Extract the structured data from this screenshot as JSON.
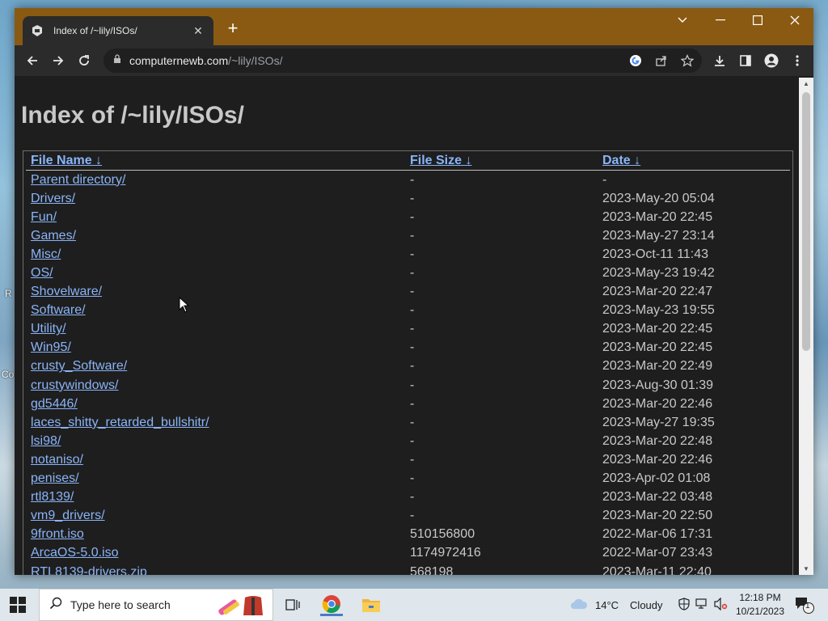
{
  "desktop": {
    "side_letters": [
      "R",
      "Co"
    ]
  },
  "browser": {
    "tab_title": "Index of /~lily/ISOs/",
    "url_domain": "computernewb.com",
    "url_path": "/~lily/ISOs/"
  },
  "page": {
    "heading": "Index of /~lily/ISOs/",
    "columns": [
      "File Name ↓",
      "File Size ↓",
      "Date ↓"
    ],
    "rows": [
      {
        "name": "Parent directory/",
        "size": "-",
        "date": "-"
      },
      {
        "name": "Drivers/",
        "size": "-",
        "date": "2023-May-20 05:04"
      },
      {
        "name": "Fun/",
        "size": "-",
        "date": "2023-Mar-20 22:45"
      },
      {
        "name": "Games/",
        "size": "-",
        "date": "2023-May-27 23:14"
      },
      {
        "name": "Misc/",
        "size": "-",
        "date": "2023-Oct-11 11:43"
      },
      {
        "name": "OS/",
        "size": "-",
        "date": "2023-May-23 19:42"
      },
      {
        "name": "Shovelware/",
        "size": "-",
        "date": "2023-Mar-20 22:47"
      },
      {
        "name": "Software/",
        "size": "-",
        "date": "2023-May-23 19:55"
      },
      {
        "name": "Utility/",
        "size": "-",
        "date": "2023-Mar-20 22:45"
      },
      {
        "name": "Win95/",
        "size": "-",
        "date": "2023-Mar-20 22:45"
      },
      {
        "name": "crusty_Software/",
        "size": "-",
        "date": "2023-Mar-20 22:49"
      },
      {
        "name": "crustywindows/",
        "size": "-",
        "date": "2023-Aug-30 01:39"
      },
      {
        "name": "gd5446/",
        "size": "-",
        "date": "2023-Mar-20 22:46"
      },
      {
        "name": "laces_shitty_retarded_bullshitr/",
        "size": "-",
        "date": "2023-May-27 19:35"
      },
      {
        "name": "lsi98/",
        "size": "-",
        "date": "2023-Mar-20 22:48"
      },
      {
        "name": "notaniso/",
        "size": "-",
        "date": "2023-Mar-20 22:46"
      },
      {
        "name": "penises/",
        "size": "-",
        "date": "2023-Apr-02 01:08"
      },
      {
        "name": "rtl8139/",
        "size": "-",
        "date": "2023-Mar-22 03:48"
      },
      {
        "name": "vm9_drivers/",
        "size": "-",
        "date": "2023-Mar-20 22:50"
      },
      {
        "name": "9front.iso",
        "size": "510156800",
        "date": "2022-Mar-06 17:31"
      },
      {
        "name": "ArcaOS-5.0.iso",
        "size": "1174972416",
        "date": "2022-Mar-07 23:43"
      },
      {
        "name": "RTL8139-drivers.zip",
        "size": "568198",
        "date": "2023-Mar-11 22:40"
      }
    ]
  },
  "taskbar": {
    "search_placeholder": "Type here to search",
    "weather_temp": "14°C",
    "weather_desc": "Cloudy",
    "time": "12:18 PM",
    "date": "10/21/2023",
    "notification_count": "1"
  },
  "colors": {
    "titlebar": "#8a5a12",
    "link": "#8ab4f8",
    "page_bg": "#1e1e1e"
  }
}
